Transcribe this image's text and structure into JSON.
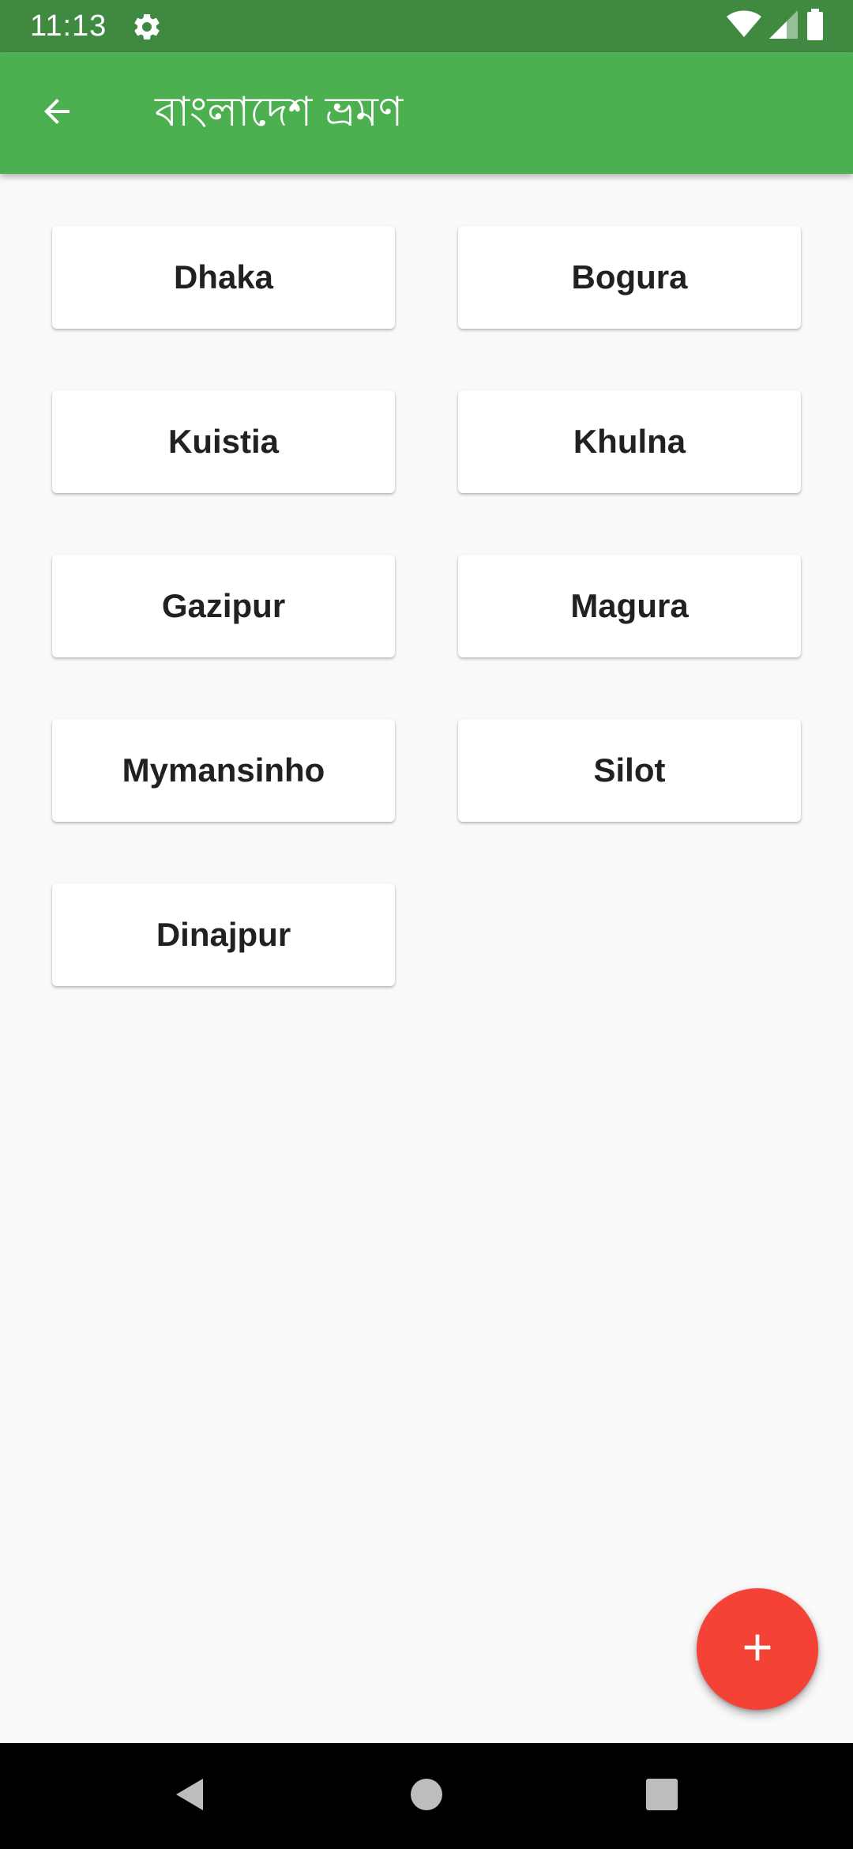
{
  "status_bar": {
    "time": "11:13",
    "icons": [
      "gear-icon",
      "wifi-icon",
      "signal-icon",
      "battery-icon"
    ]
  },
  "app_bar": {
    "title": "বাংলাদেশ ভ্রমণ",
    "back_icon": "arrow-back-icon"
  },
  "cities": [
    {
      "label": "Dhaka"
    },
    {
      "label": "Bogura"
    },
    {
      "label": "Kuistia"
    },
    {
      "label": "Khulna"
    },
    {
      "label": "Gazipur"
    },
    {
      "label": "Magura"
    },
    {
      "label": "Mymansinho"
    },
    {
      "label": "Silot"
    },
    {
      "label": "Dinajpur"
    }
  ],
  "fab": {
    "icon": "plus-icon"
  },
  "nav_bar": {
    "buttons": [
      "back-triangle-icon",
      "home-circle-icon",
      "recents-square-icon"
    ]
  },
  "colors": {
    "app_bar": "#4caf50",
    "status_bar": "#3f8a40",
    "fab": "#f44336",
    "background": "#fafafa",
    "card": "#ffffff",
    "card_text": "#212121"
  }
}
